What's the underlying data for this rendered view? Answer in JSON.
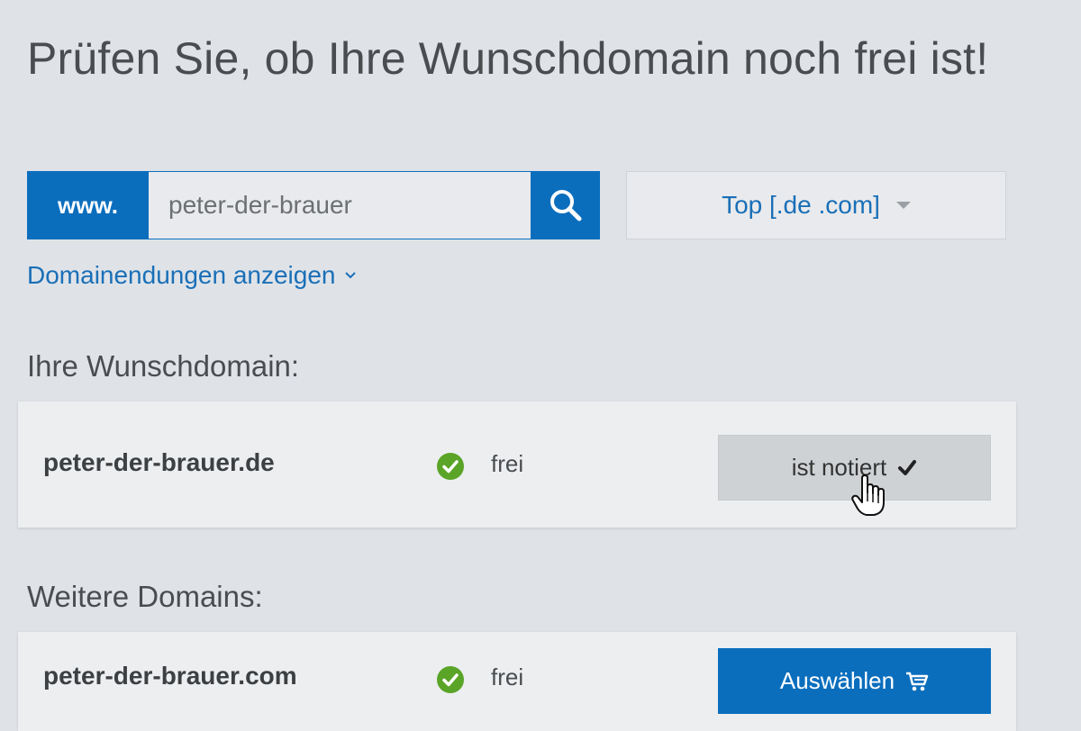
{
  "page": {
    "title": "Prüfen Sie, ob Ihre Wunschdomain noch frei ist!"
  },
  "search": {
    "prefix": "www.",
    "value": "peter-der-brauer",
    "button_icon": "search-icon"
  },
  "tld_filter": {
    "selected": "Top [.de .com]",
    "icon": "caret-down-icon"
  },
  "show_endings": {
    "label": "Domainendungen anzeigen",
    "icon": "chevron-down-icon"
  },
  "wish_domain": {
    "heading": "Ihre Wunschdomain:",
    "name": "peter-der-brauer.de",
    "status": "frei",
    "status_icon": "check-circle-icon",
    "button_label": "ist notiert",
    "button_icon": "checkmark-icon"
  },
  "more_domains": {
    "heading": "Weitere Domains:",
    "items": [
      {
        "name": "peter-der-brauer.com",
        "status": "frei",
        "status_icon": "check-circle-icon",
        "button_label": "Auswählen",
        "button_icon": "cart-icon"
      }
    ]
  },
  "colors": {
    "primary": "#0b6ebd",
    "link": "#1a6fb7",
    "status_ok": "#5aa427",
    "background": "#dfe3e8"
  }
}
